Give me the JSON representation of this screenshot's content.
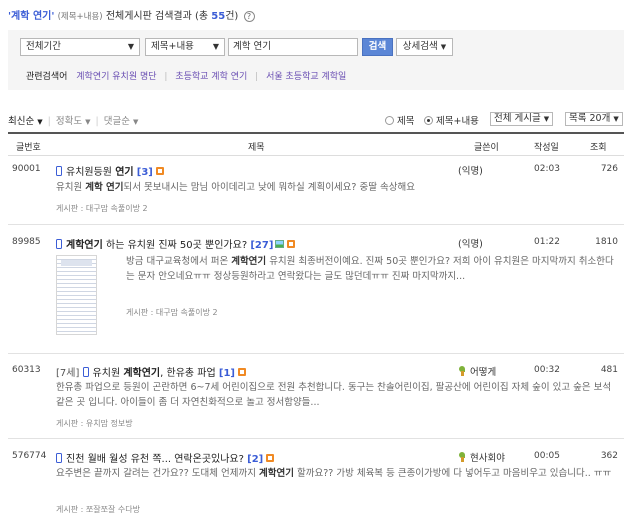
{
  "header": {
    "query": "'계학 연기'",
    "scope": "(제목+내용)",
    "text_prefix": "전체게시판 검색결과 (총",
    "count": "55",
    "text_suffix": "건)",
    "help_glyph": "?"
  },
  "search": {
    "period": "전체기간",
    "field": "제목+내용",
    "query_value": "계학 연기",
    "search_button": "검색",
    "advanced_button": "상세검색"
  },
  "related": {
    "label": "관련검색어",
    "terms": [
      "계학연기 유치원 명단",
      "초등학교 계학 연기",
      "서울 초등학교 계학일"
    ]
  },
  "sort": {
    "latest": "최신순",
    "accuracy": "정확도",
    "comments": "댓글순",
    "filter_title": "제목",
    "filter_title_content": "제목+내용",
    "board_filter": "전체 게시글",
    "per_page": "목록 20개"
  },
  "table": {
    "columns": [
      "글번호",
      "제목",
      "글쓴이",
      "작성일",
      "조회"
    ],
    "rows": [
      {
        "num": "90001",
        "t1": "유치원등원 ",
        "hl": "연기",
        "comments": "[3]",
        "author": "(익명)",
        "time": "02:03",
        "views": "726",
        "ex1": "유치원 ",
        "exhl": "계학 연기",
        "ex2": "되서 못보내시는 맘님 아이데리고 낮에 뭐하실 계획이세요? 중딸 속상해요",
        "board": "게시판 : 대구맘 속풀이방 2"
      },
      {
        "num": "89985",
        "hl": "계학연기",
        "t1": " 하는 유치원 진짜 50곳 뿐인가요?",
        "comments": "[27]",
        "author": "(익명)",
        "time": "01:22",
        "views": "1810",
        "ex1": "방금 대구교육청에서 퍼온 ",
        "exhl": "계학연기",
        "ex2": " 유치원 최종버전이예요. 진짜 50곳 뿐인가요? 저희 아이 유치원은 마지막까지 취소한다는 문자 안오네요ㅠㅠ 정상등원하라고 연락왔다는 글도 많던데ㅠㅠ 진짜 마지막까지...",
        "board": "게시판 : 대구맘 속풀이방 2"
      },
      {
        "num": "60313",
        "pre": "[7세] ",
        "t1": "유치원 ",
        "hl": "계학연기",
        "t2": ", 한유총 파업",
        "comments": "[1]",
        "author": "어떻게",
        "time": "00:32",
        "views": "481",
        "ex1": "한유총 파업으로 등원이 곤란하면 6~7세 어린이집으로 전원 추천합니다. 동구는 찬솔어린이집, 팔공산에 어린이집 자체 숲이 있고 숲은 보석 같은 곳 입니다. 아이들이 좀 더 자연친화적으로 놀고 정서함양들...",
        "board": "게시판 : 유치맘 정보방"
      },
      {
        "num": "576774",
        "t1": "진천 월배 월성 유천 쪽... 연락온곳있나요?",
        "comments": "[2]",
        "author": "현사회야",
        "time": "00:05",
        "views": "362",
        "ex1": "요주변은 끝까지 갈려는 건가요?? 도대체 언제까지 ",
        "exhl": "계학연기",
        "ex2": " 할까요?? 가방 체육복 등 큰종이가방에 다 넣어두고 마음비우고 있습니다.. ㅠㅠ",
        "board": "게시판 : 쪼잘쪼잘 수다방"
      }
    ]
  }
}
